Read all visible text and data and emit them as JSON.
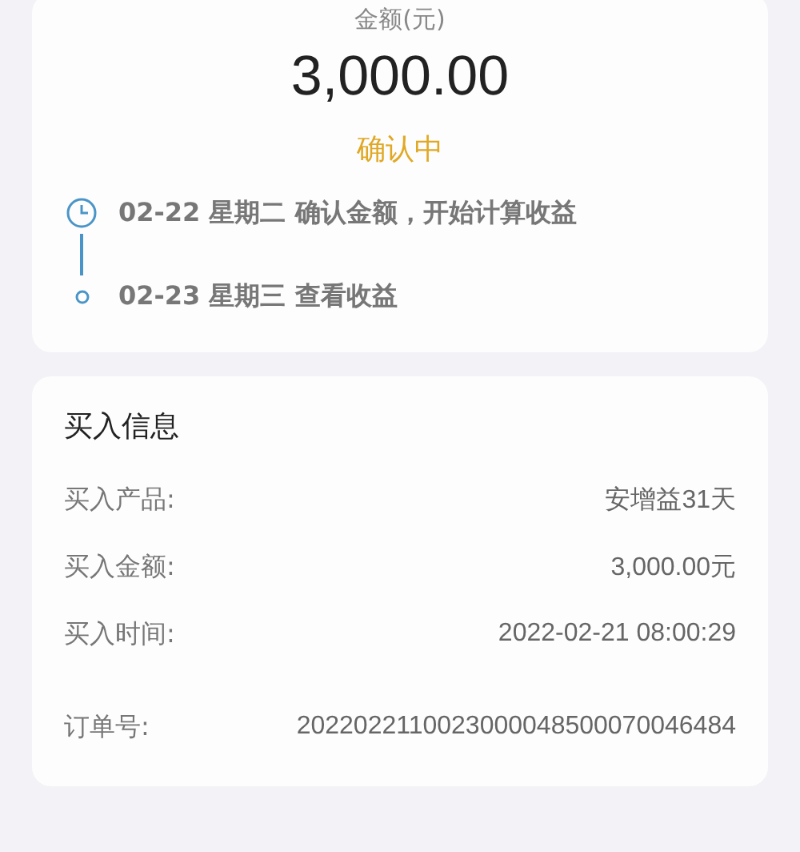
{
  "summary": {
    "amount_label": "金额(元)",
    "amount": "3,000.00",
    "status": "确认中",
    "timeline": [
      {
        "kind": "clock",
        "text": "02-22 星期二 确认金额，开始计算收益"
      },
      {
        "kind": "dot",
        "text": "02-23 星期三 查看收益"
      }
    ]
  },
  "purchase_info": {
    "title": "买入信息",
    "rows": [
      {
        "label": "买入产品:",
        "value": "安增益31天"
      },
      {
        "label": "买入金额:",
        "value": "3,000.00元"
      },
      {
        "label": "买入时间:",
        "value": "2022-02-21 08:00:29"
      }
    ],
    "order": {
      "label": "订单号:",
      "value": "2022022110023000048500070046484"
    }
  }
}
